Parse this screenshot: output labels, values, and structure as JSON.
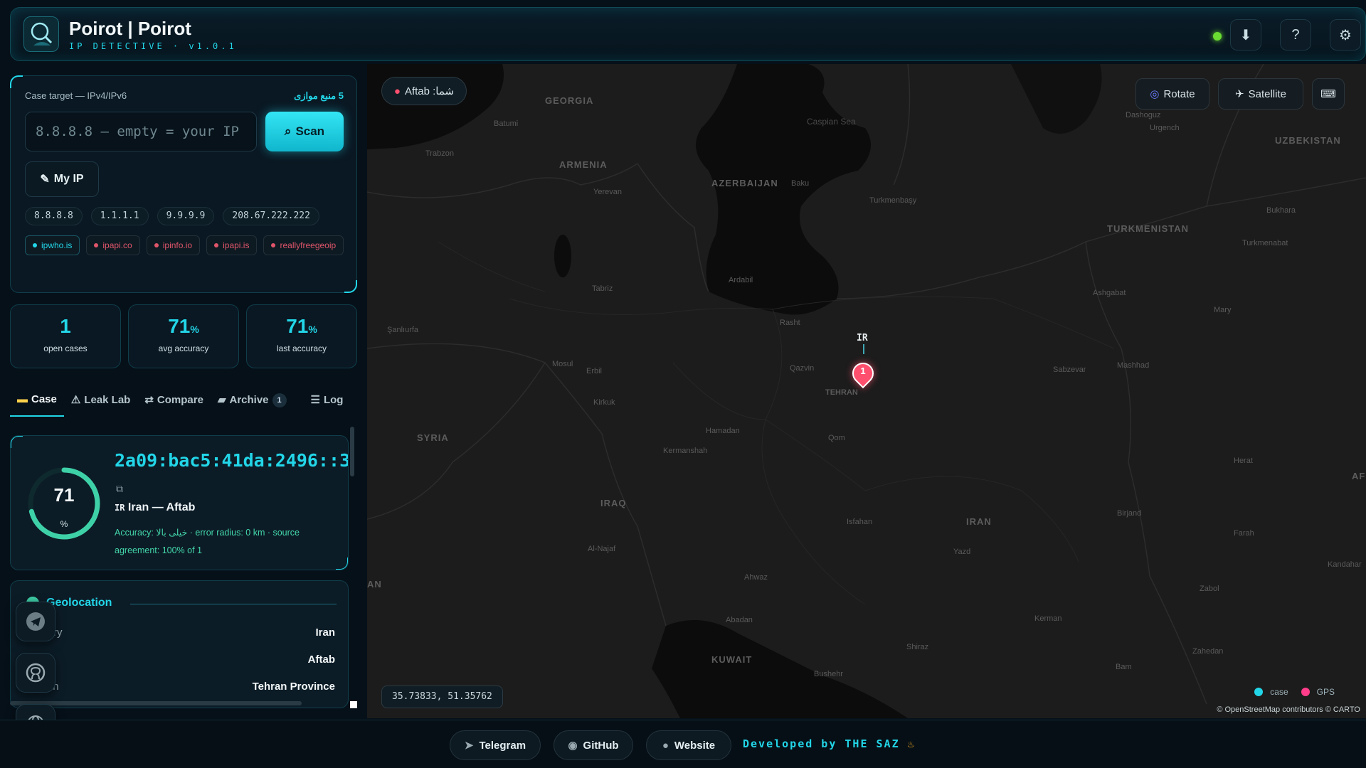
{
  "header": {
    "title": "Poirot | Poirot",
    "subtitle": "IP DETECTIVE · v1.0.1",
    "buttons": [
      "download-icon",
      "help-icon",
      "settings-icon"
    ],
    "status_color": "#6bdc32"
  },
  "lookup": {
    "label": "Case target — IPv4/IPv6",
    "parallel_sources": "5 منبع موازی",
    "input_placeholder": "8.8.8.8 — empty = your IP",
    "scan_label": "Scan",
    "myip_label": "My IP",
    "quick_ips": [
      "8.8.8.8",
      "1.1.1.1",
      "9.9.9.9",
      "208.67.222.222"
    ],
    "sources": [
      {
        "name": "ipwho.is",
        "active": true
      },
      {
        "name": "ipapi.co",
        "active": false
      },
      {
        "name": "ipinfo.io",
        "active": false
      },
      {
        "name": "ipapi.is",
        "active": false
      },
      {
        "name": "reallyfreegeoip",
        "active": false
      }
    ]
  },
  "stats": [
    {
      "value": "1",
      "unit": "",
      "label": "open cases"
    },
    {
      "value": "71",
      "unit": "%",
      "label": "avg accuracy"
    },
    {
      "value": "71",
      "unit": "%",
      "label": "last accuracy"
    }
  ],
  "tabs": [
    {
      "label": "Case",
      "icon": "folder-icon",
      "active": true
    },
    {
      "label": "Leak Lab",
      "icon": "warning-icon",
      "active": false
    },
    {
      "label": "Compare",
      "icon": "swap-icon",
      "active": false
    },
    {
      "label": "Archive",
      "icon": "archive-icon",
      "active": false,
      "badge": "1"
    },
    {
      "label": "Log",
      "icon": "list-icon",
      "active": false
    }
  ],
  "case": {
    "ip": "2a09:bac5:41da:2496::3",
    "score": "71",
    "score_unit": "%",
    "score_fraction": 0.71,
    "country_code": "IR",
    "country_line": "Iran — Aftab",
    "accuracy_text": "Accuracy: خیلی بالا · error radius: 0 km · source agreement: 100% of 1"
  },
  "geolocation": {
    "title": "Geolocation",
    "rows": [
      {
        "key": "Country",
        "value": "Iran"
      },
      {
        "key": "ISP",
        "value": "Aftab"
      },
      {
        "key": "Region",
        "value": "Tehran Province"
      }
    ]
  },
  "map": {
    "location_pill": "شما: Aftab",
    "rotate_label": "Rotate",
    "satellite_label": "Satellite",
    "marker_country": "IR",
    "marker_number": "1",
    "coords": "35.73833, 51.35762",
    "legend": [
      {
        "label": "case",
        "color": "#22d6e8"
      },
      {
        "label": "GPS",
        "color": "#ff3d8a"
      }
    ],
    "attribution": "© OpenStreetMap contributors © CARTO",
    "country_labels": [
      "GEORGIA",
      "ARMENIA",
      "AZERBAIJAN",
      "TURKMENISTAN",
      "UZBEKISTAN",
      "SYRIA",
      "IRAQ",
      "IRAN",
      "KUWAIT",
      "AF",
      "AN"
    ],
    "cities": [
      "Batumi",
      "Trabzon",
      "Yerevan",
      "Baku",
      "Tabriz",
      "Ardabil",
      "Şanlıurfa",
      "Rasht",
      "Mosul",
      "Erbil",
      "Qazvin",
      "TEHRAN",
      "Kirkuk",
      "Hamadan",
      "Qom",
      "Kermanshah",
      "Isfahan",
      "Al-Najaf",
      "Ahwaz",
      "Abadan",
      "Yazd",
      "Shiraz",
      "Bushehr",
      "Kerman",
      "Bam",
      "Zahedan",
      "Birjand",
      "Farah",
      "Herat",
      "Zabol",
      "Kandahar",
      "Mashhad",
      "Sabzevar",
      "Ashgabat",
      "Mary",
      "Turkmenabat",
      "Bukhara",
      "Dashoguz",
      "Urgench",
      "Turkmenbaşy"
    ],
    "caspian_label": "Caspian Sea"
  },
  "footer": {
    "telegram": "Telegram",
    "github": "GitHub",
    "website": "Website",
    "developer": "Developed by THE SAZ"
  }
}
